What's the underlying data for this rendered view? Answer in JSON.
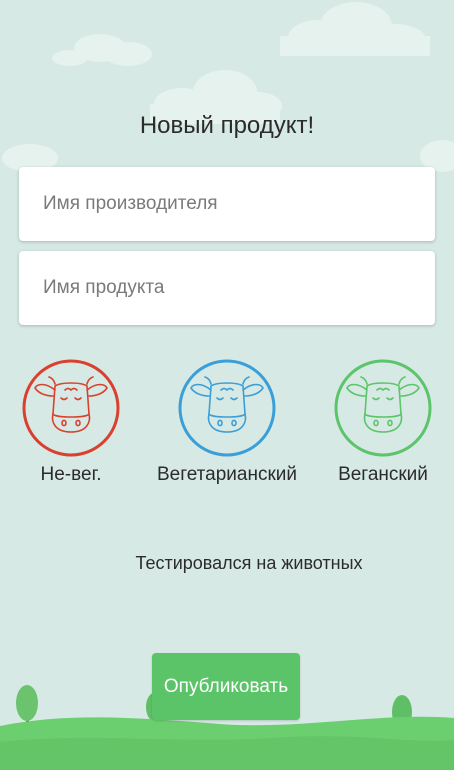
{
  "header": {
    "title": "Новый продукт!"
  },
  "form": {
    "manufacturer_placeholder": "Имя производителя",
    "manufacturer_value": "",
    "product_placeholder": "Имя продукта",
    "product_value": ""
  },
  "diet_options": [
    {
      "label": "Не-вег.",
      "icon": "cow-icon",
      "color": "#d9412e"
    },
    {
      "label": "Вегетарианский",
      "icon": "cow-icon",
      "color": "#3a9fd8"
    },
    {
      "label": "Веганский",
      "icon": "cow-icon",
      "color": "#5cc46a"
    }
  ],
  "animal_testing": {
    "label": "Тестировался на животных"
  },
  "actions": {
    "publish_label": "Опубликовать",
    "publish_color": "#5cc468"
  },
  "theme": {
    "background": "#d6e9e4",
    "ground": "#6bcf6f",
    "cloud": "#eaf4f1"
  }
}
